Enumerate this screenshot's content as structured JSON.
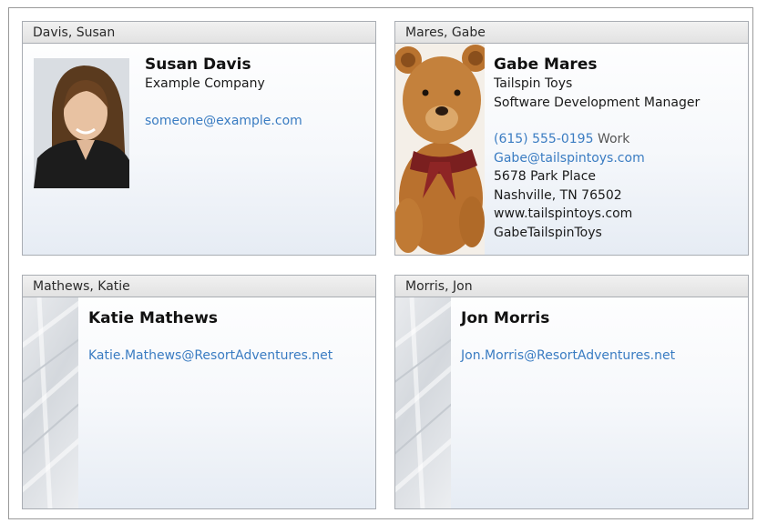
{
  "cards": [
    {
      "header": "Davis, Susan",
      "name": "Susan Davis",
      "company": "Example Company",
      "email": "someone@example.com"
    },
    {
      "header": "Mares, Gabe",
      "name": "Gabe Mares",
      "company": "Tailspin Toys",
      "title": "Software Development Manager",
      "phone": "(615) 555-0195",
      "phone_type": "Work",
      "email": "Gabe@tailspintoys.com",
      "address_line1": "5678 Park Place",
      "address_line2": "Nashville, TN 76502",
      "website": "www.tailspintoys.com",
      "im": "GabeTailspinToys"
    },
    {
      "header": "Mathews, Katie",
      "name": "Katie Mathews",
      "email": "Katie.Mathews@ResortAdventures.net"
    },
    {
      "header": "Morris, Jon",
      "name": "Jon Morris",
      "email": "Jon.Morris@ResortAdventures.net"
    }
  ]
}
